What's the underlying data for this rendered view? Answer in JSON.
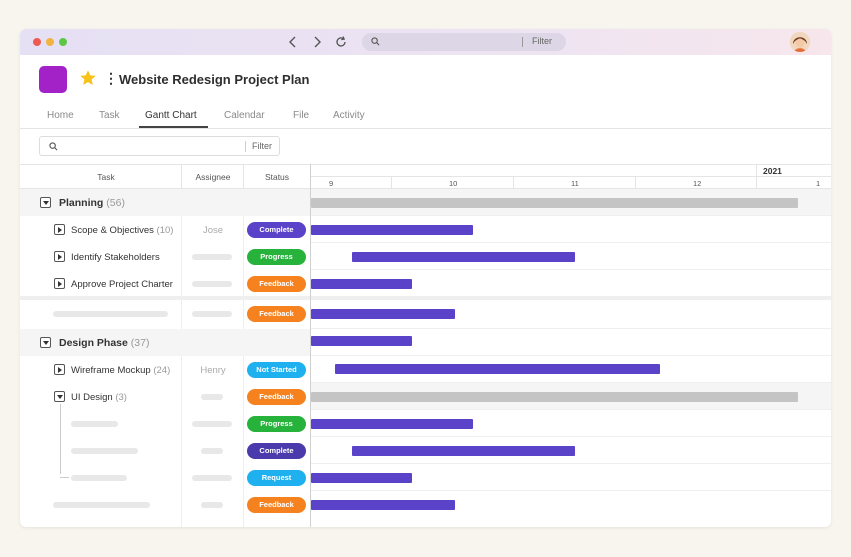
{
  "browser": {
    "back_icon": "chevron-left-icon",
    "forward_icon": "chevron-right-icon",
    "reload_icon": "reload-icon",
    "url_placeholder": "Filter"
  },
  "project": {
    "title": "Website Redesign Project Plan",
    "icon_color": "#a322c8"
  },
  "tabs": [
    {
      "label": "Home",
      "active": false
    },
    {
      "label": "Task",
      "active": false
    },
    {
      "label": "Gantt Chart",
      "active": true
    },
    {
      "label": "Calendar",
      "active": false
    },
    {
      "label": "File",
      "active": false
    },
    {
      "label": "Activity",
      "active": false
    }
  ],
  "filter": {
    "placeholder": "Filter"
  },
  "columns": {
    "task": "Task",
    "assignee": "Assignee",
    "status": "Status"
  },
  "timeline": {
    "year": "2021",
    "dates": [
      "9",
      "10",
      "11",
      "12",
      "1"
    ]
  },
  "status_colors": {
    "Complete": "#5a42c9",
    "Progress": "#27b23c",
    "Feedback": "#f5821f",
    "Not Started": "#1fb0f0",
    "Request": "#1fb0f0"
  },
  "groups": [
    {
      "name": "Planning",
      "count": "(56)",
      "rows": [
        {
          "name": "Scope & Objectives",
          "count": "(10)",
          "assignee": "Jose",
          "status": "Complete"
        },
        {
          "name": "Identify Stakeholders",
          "count": "",
          "assignee": "",
          "status": "Progress"
        },
        {
          "name": "Approve Project Charter",
          "count": "",
          "assignee": "",
          "status": "Feedback"
        },
        {
          "name": "",
          "count": "",
          "assignee": "",
          "status": "Feedback"
        }
      ]
    },
    {
      "name": "Design Phase",
      "count": "(37)",
      "rows": [
        {
          "name": "Wireframe Mockup",
          "count": "(24)",
          "assignee": "Henry",
          "status": "Not Started"
        },
        {
          "name": "UI Design",
          "count": "(3)",
          "assignee": "",
          "status": "Feedback"
        },
        {
          "name": "",
          "count": "",
          "assignee": "",
          "status": "Progress"
        },
        {
          "name": "",
          "count": "",
          "assignee": "",
          "status": "Complete"
        },
        {
          "name": "",
          "count": "",
          "assignee": "",
          "status": "Request"
        },
        {
          "name": "",
          "count": "",
          "assignee": "",
          "status": "Feedback"
        }
      ]
    }
  ]
}
